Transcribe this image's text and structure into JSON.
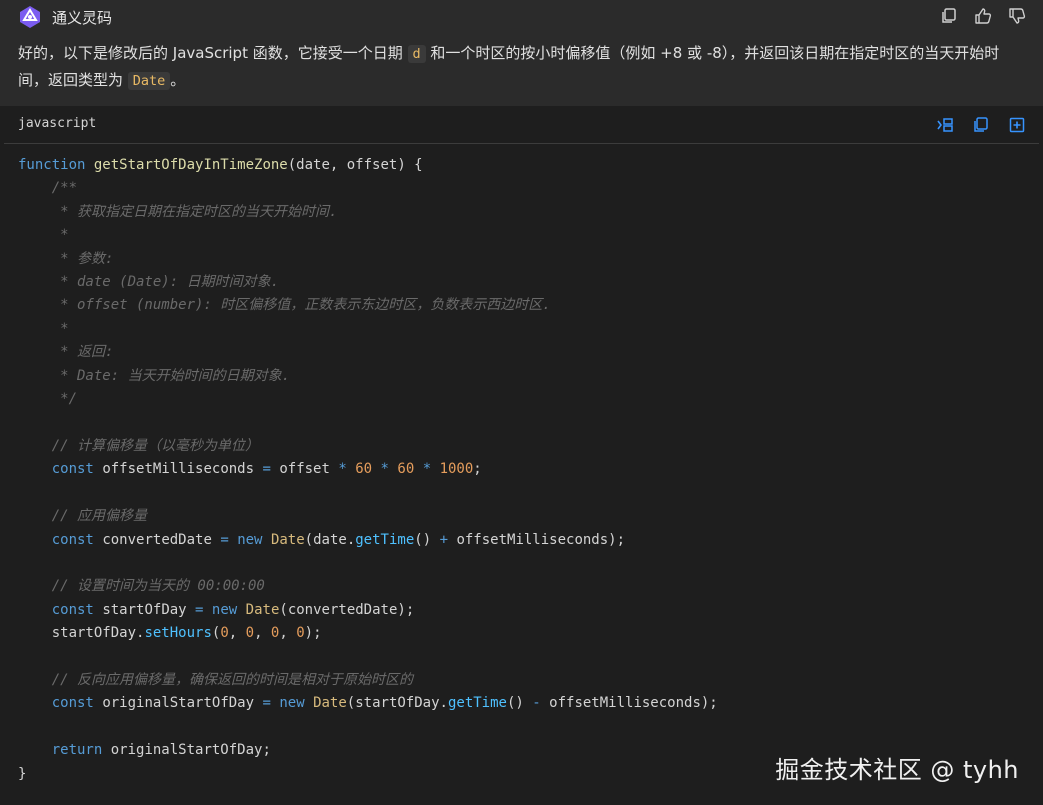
{
  "assistant": {
    "name": "通义灵码",
    "logo_icon": "tongyi-logo-icon",
    "actions": [
      "copy-icon",
      "thumbs-up-icon",
      "thumbs-down-icon"
    ]
  },
  "message": {
    "part1": "好的，以下是修改后的 JavaScript 函数，它接受一个日期 ",
    "code1": "d",
    "part2": " 和一个时区的按小时偏移值（例如 +8 或 -8），并返回该日期在指定时区的当天开始时间，返回类型为 ",
    "code2": "Date",
    "part3": "。"
  },
  "code_block": {
    "language": "javascript",
    "actions": [
      "insert-icon",
      "copy-icon",
      "new-file-icon"
    ],
    "lines": {
      "l1_kw": "function",
      "l1_fn": "getStartOfDayInTimeZone",
      "l1_rest": "(date, offset) {",
      "c1": "    /**",
      "c2": "     * 获取指定日期在指定时区的当天开始时间.",
      "c3": "     *",
      "c4": "     * 参数:",
      "c5": "     * date (Date): 日期时间对象.",
      "c6": "     * offset (number): 时区偏移值，正数表示东边时区，负数表示西边时区.",
      "c7": "     *",
      "c8": "     * 返回:",
      "c9": "     * Date: 当天开始时间的日期对象.",
      "c10": "     */",
      "cm1": "    // 计算偏移量（以毫秒为单位）",
      "cm2": "    // 应用偏移量",
      "cm3": "    // 设置时间为当天的 00:00:00",
      "cm4": "    // 反向应用偏移量，确保返回的时间是相对于原始时区的",
      "const": "const",
      "new": "new",
      "date_cls": "Date",
      "return": "return",
      "v_offsetMs": "offsetMilliseconds",
      "v_offset": "offset",
      "v_converted": "convertedDate",
      "v_date": "date",
      "m_getTime": "getTime",
      "v_startOfDay": "startOfDay",
      "m_setHours": "setHours",
      "v_original": "originalStartOfDay",
      "n60": "60",
      "n1000": "1000",
      "n0": "0",
      "close": "}"
    }
  },
  "watermark": "掘金技术社区 @ tyhh"
}
